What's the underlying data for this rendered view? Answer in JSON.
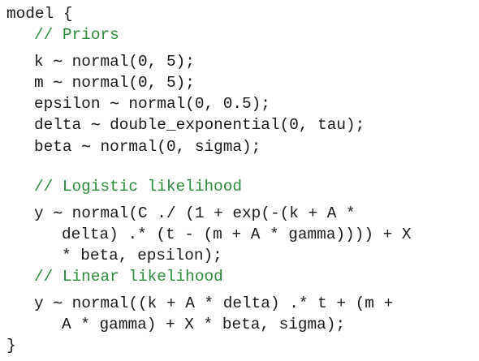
{
  "code": {
    "open": "model {",
    "comment_priors": "// Priors",
    "prior_k": "k ∼ normal(0, 5);",
    "prior_m": "m ∼ normal(0, 5);",
    "prior_epsilon": "epsilon ∼ normal(0, 0.5);",
    "prior_delta": "delta ∼ double_exponential(0, tau);",
    "prior_beta": "beta ∼ normal(0, sigma);",
    "comment_logistic": "// Logistic likelihood",
    "logistic_1": "y ∼ normal(C ./ (1 + exp(-(k + A *",
    "logistic_2": "delta) .* (t - (m + A * gamma)))) + X",
    "logistic_3": "* beta, epsilon);",
    "comment_linear": "// Linear likelihood",
    "linear_1": "y ∼ normal((k + A * delta) .* t + (m +",
    "linear_2": "A * gamma) + X * beta, sigma);",
    "close": "}"
  },
  "colors": {
    "text": "#1a1a1a",
    "comment": "#2e8b3e",
    "background": "#ffffff"
  }
}
